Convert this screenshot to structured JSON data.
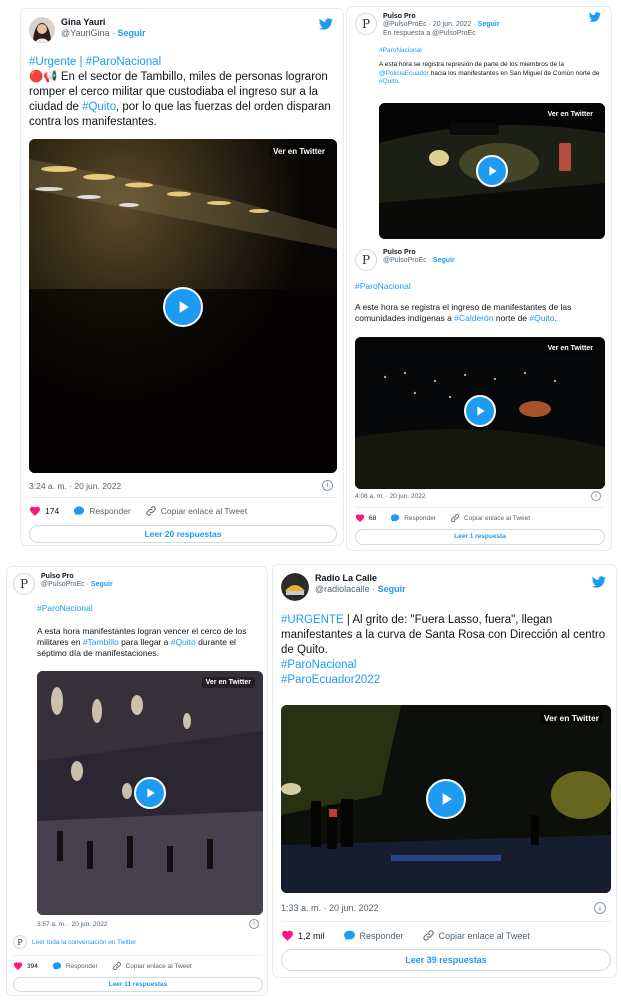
{
  "colors": {
    "accent": "#1d9bf0",
    "heart": "#f91880",
    "text": "#0f1419",
    "muted": "#536471"
  },
  "tweet1": {
    "name": "Gina Yauri",
    "handle": "@YauriGina",
    "follow": "Seguir",
    "tags": "#Urgente | #ParoNacional",
    "emoji": "🔴📢",
    "text_a": " En el sector de Tambillo, miles de personas lograron romper el cerco militar que custodiaba el ingreso sur a la ciudad de ",
    "link": "#Quito",
    "text_b": ", por lo que las fuerzas del orden disparan contra los manifestantes.",
    "video_label": "Ver en Twitter",
    "timestamp": "3:24 a. m. · 20 jun. 2022",
    "likes": "174",
    "reply": "Responder",
    "copy": "Copiar enlace al Tweet",
    "read": "Leer 20 respuestas"
  },
  "tweet2": {
    "name": "Pulso Pro",
    "handle_time": "@PulsoProEc · 20 jun. 2022",
    "follow": "Seguir",
    "reply_to": "En respuesta a @PulsoProEc",
    "tag": "#ParoNacional",
    "text_a": "A esta hora se registra represión de parte de los miembros de la ",
    "link1": "@PoliciaEcuador",
    "text_b": " hacia los manifestantes en San Miguel de Común norte de ",
    "link2": "#Quito",
    "text_c": ".",
    "video_label": "Ver en Twitter"
  },
  "tweet3": {
    "name": "Pulso Pro",
    "handle": "@PulsoProEc",
    "follow": "Seguir",
    "tag": "#ParoNacional",
    "text_a": "A este hora se registra el ingreso de manifestantes de las comunidades indígenas a ",
    "link1": "#Calderón",
    "text_b": " norte de ",
    "link2": "#Quito",
    "text_c": ".",
    "video_label": "Ver en Twitter",
    "timestamp": "4:08 a. m. · 20 jun. 2022",
    "likes": "68",
    "reply": "Responder",
    "copy": "Copiar enlace al Tweet",
    "read": "Leer 1 respuesta"
  },
  "tweet4": {
    "name": "Pulso Pro",
    "handle": "@PulsoProEc",
    "follow": "Seguir",
    "tag": "#ParoNacional",
    "text_a": "A esta hora manifestantes logran vencer el cerco de los militares en ",
    "link1": "#Tambillo",
    "text_b": " para llegar a ",
    "link2": "#Quito",
    "text_c": " durante el séptimo día de manifestaciones.",
    "video_label": "Ver en Twitter",
    "timestamp": "3:57 a. m. · 20 jun. 2022",
    "convo": "Leer toda la conversación en Twitter",
    "likes": "394",
    "reply": "Responder",
    "copy": "Copiar enlace al Tweet",
    "read": "Leer 11 respuestas"
  },
  "tweet5": {
    "name": "Radio La Calle",
    "handle": "@radiolacalle",
    "follow": "Seguir",
    "tag1": "#URGENTE",
    "text_a": " | Al grito de: \"Fuera Lasso, fuera\", llegan manifestantes a la curva de Santa Rosa con Dirección al centro de Quito.",
    "tag2": "#ParoNacional",
    "tag3": "#ParoEcuador2022",
    "video_label": "Ver en Twitter",
    "timestamp": "1:33 a. m. · 20 jun. 2022",
    "likes": "1,2 mil",
    "reply": "Responder",
    "copy": "Copiar enlace al Tweet",
    "read": "Leer 39 respuestas"
  }
}
